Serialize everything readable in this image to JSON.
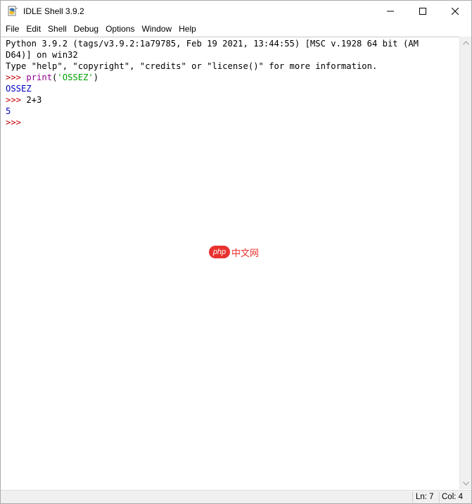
{
  "window": {
    "title": "IDLE Shell 3.9.2",
    "icon": "python-idle-icon"
  },
  "menu": [
    "File",
    "Edit",
    "Shell",
    "Debug",
    "Options",
    "Window",
    "Help"
  ],
  "shell": {
    "banner_line1": "Python 3.9.2 (tags/v3.9.2:1a79785, Feb 19 2021, 13:44:55) [MSC v.1928 64 bit (AM",
    "banner_line2": "D64)] on win32",
    "banner_line3": "Type \"help\", \"copyright\", \"credits\" or \"license()\" for more information.",
    "prompt": ">>> ",
    "cmd1_func": "print",
    "cmd1_open": "(",
    "cmd1_string": "'OSSEZ'",
    "cmd1_close": ")",
    "output1": "OSSEZ",
    "cmd2": "2+3",
    "output2": "5",
    "prompt_final": ">>>"
  },
  "watermark": {
    "badge": "php",
    "text": "中文网"
  },
  "status": {
    "ln": "Ln: 7",
    "col": "Col: 4"
  },
  "colors": {
    "prompt": "#c00000",
    "builtin": "#900090",
    "string": "#00a000",
    "stdout": "#0000c0"
  }
}
